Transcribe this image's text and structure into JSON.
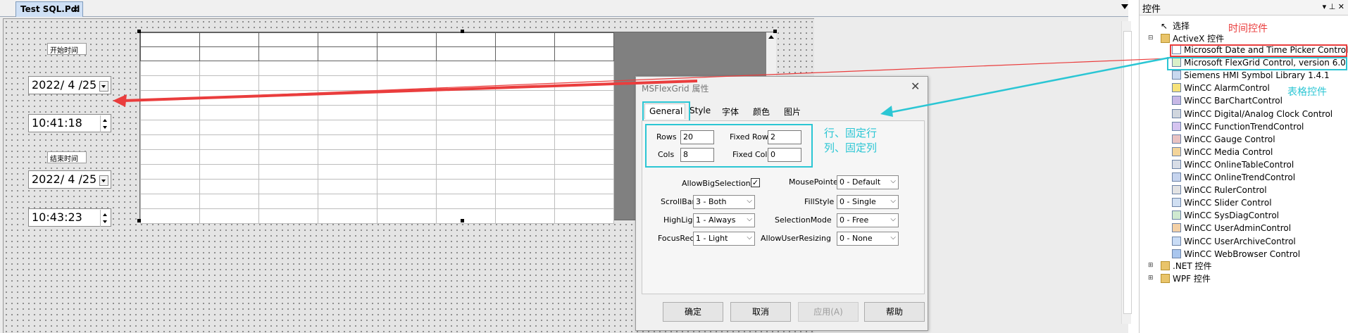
{
  "editor": {
    "tab_label": "Test SQL.Pdl",
    "tab_close": "×",
    "start_label": "开始时间",
    "end_label": "结束时间",
    "start_date": "2022/ 4 /25",
    "start_time": "10:41:18",
    "end_date": "2022/ 4 /25",
    "end_time": "10:43:23"
  },
  "grid": {
    "columns": 8,
    "fixed_rows": 2,
    "visible_rows": 13
  },
  "dialog": {
    "title": "MSFlexGrid 属性",
    "close": "✕",
    "tabs": [
      "General",
      "Style",
      "字体",
      "颜色",
      "图片"
    ],
    "active_tab": "General",
    "rows_label": "Rows",
    "rows_value": "20",
    "fixed_rows_label": "Fixed Rows",
    "fixed_rows_value": "2",
    "cols_label": "Cols",
    "cols_value": "8",
    "fixed_cols_label": "Fixed Cols",
    "fixed_cols_value": "0",
    "allow_big_selection_label": "AllowBigSelection",
    "allow_big_selection_checked": "✓",
    "scrollbars_label": "ScrollBars",
    "scrollbars_value": "3 - Both",
    "highlight_label": "HighLight",
    "highlight_value": "1 - Always",
    "focusrect_label": "FocusRect",
    "focusrect_value": "1 - Light",
    "mousepointer_label": "MousePointer",
    "mousepointer_value": "0 - Default",
    "fillstyle_label": "FillStyle",
    "fillstyle_value": "0 - Single",
    "selectionmode_label": "SelectionMode",
    "selectionmode_value": "0 - Free",
    "allowuserresizing_label": "AllowUserResizing",
    "allowuserresizing_value": "0 - None",
    "ok": "确定",
    "cancel": "取消",
    "apply": "应用(A)",
    "help": "帮助"
  },
  "annotations": {
    "time_control": "时间控件",
    "table_control": "表格控件",
    "rows_note_line1": "行、固定行",
    "rows_note_line2": "列、固定列",
    "red_color": "#ea3d3d",
    "cyan_color": "#2bc6d4"
  },
  "toolbox": {
    "title": "控件",
    "header_icons": "▾ ⊥ ✕",
    "select": "选择",
    "activex_group": "ActiveX 控件",
    "items": [
      {
        "label": "Microsoft Date and Time Picker Control",
        "icon": "calendar-icon"
      },
      {
        "label": "Microsoft FlexGrid Control, version 6.0",
        "icon": "grid-icon"
      },
      {
        "label": "Siemens HMI Symbol Library 1.4.1",
        "icon": "symbol-icon"
      },
      {
        "label": "WinCC AlarmControl",
        "icon": "alarm-icon"
      },
      {
        "label": "WinCC BarChartControl",
        "icon": "bar-chart-icon"
      },
      {
        "label": "WinCC Digital/Analog Clock Control",
        "icon": "clock-icon"
      },
      {
        "label": "WinCC FunctionTrendControl",
        "icon": "trend-icon"
      },
      {
        "label": "WinCC Gauge Control",
        "icon": "gauge-icon"
      },
      {
        "label": "WinCC Media Control",
        "icon": "media-icon"
      },
      {
        "label": "WinCC OnlineTableControl",
        "icon": "table-icon"
      },
      {
        "label": "WinCC OnlineTrendControl",
        "icon": "trend-icon"
      },
      {
        "label": "WinCC RulerControl",
        "icon": "ruler-icon"
      },
      {
        "label": "WinCC Slider Control",
        "icon": "slider-icon"
      },
      {
        "label": "WinCC SysDiagControl",
        "icon": "diagnostic-icon"
      },
      {
        "label": "WinCC UserAdminControl",
        "icon": "user-icon"
      },
      {
        "label": "WinCC UserArchiveControl",
        "icon": "archive-icon"
      },
      {
        "label": "WinCC WebBrowser Control",
        "icon": "globe-icon"
      }
    ],
    "net_group": ".NET 控件",
    "wpf_group": "WPF 控件"
  }
}
